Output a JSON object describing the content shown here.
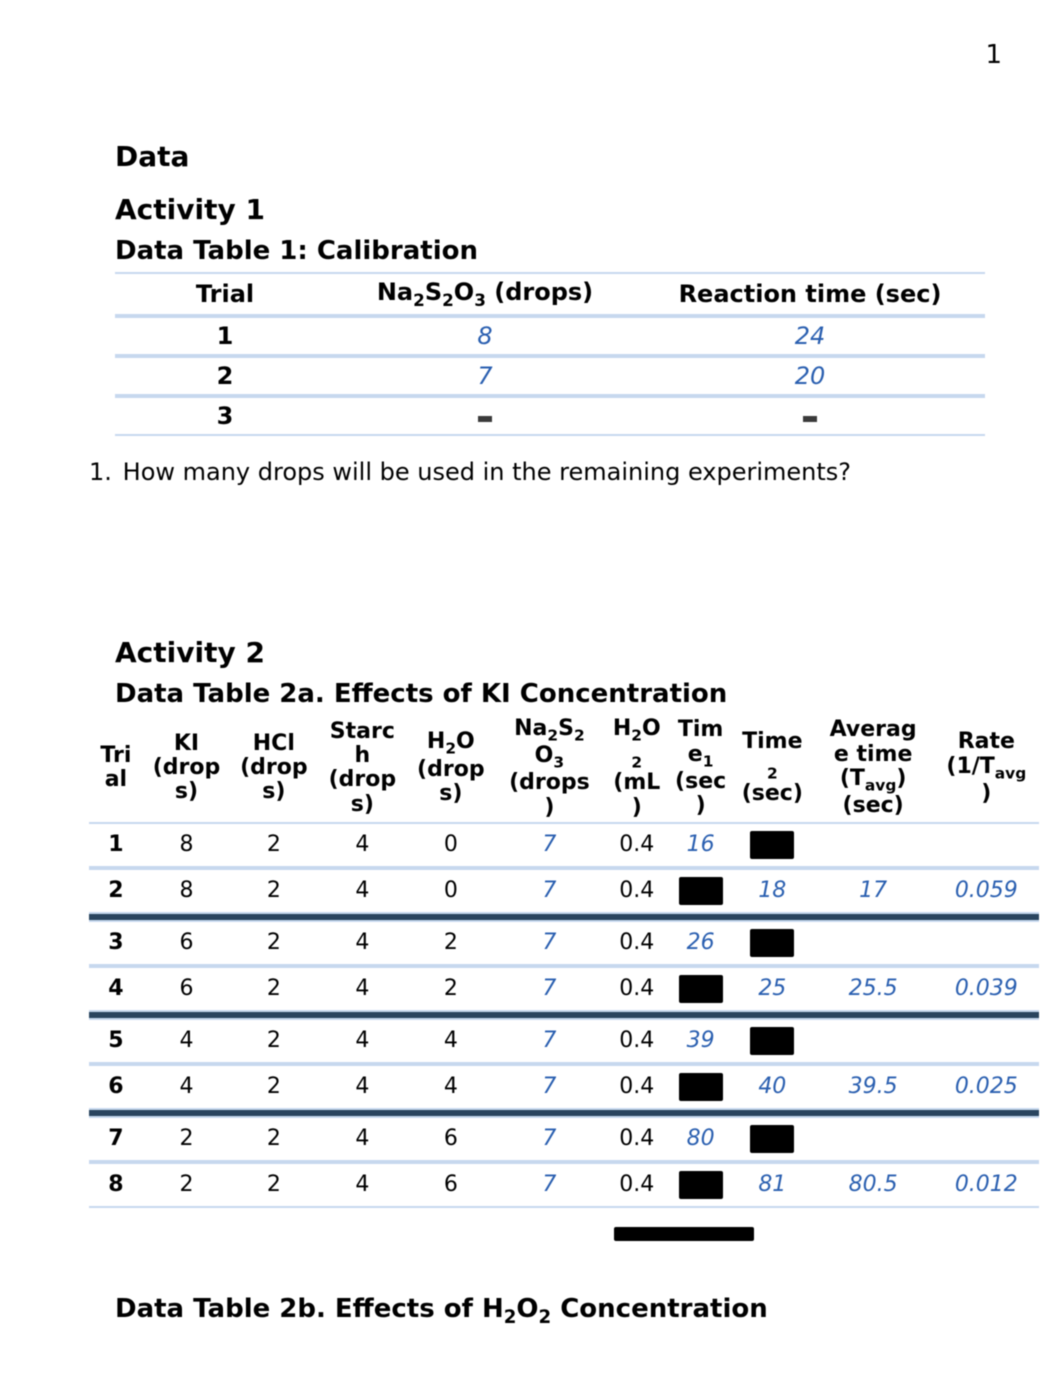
{
  "page_number": "1",
  "section_heading": "Data",
  "activity1": {
    "heading": "Activity 1",
    "table_title": "Data Table 1: Calibration",
    "headers": {
      "trial": "Trial",
      "drops_prefix": "Na",
      "drops_sub1": "2",
      "drops_mid1": "S",
      "drops_sub2": "2",
      "drops_mid2": "O",
      "drops_sub3": "3",
      "drops_suffix": " (drops)",
      "time": "Reaction time (sec)"
    },
    "rows": [
      {
        "trial": "1",
        "drops": "8",
        "time": "24"
      },
      {
        "trial": "2",
        "drops": "7",
        "time": "20"
      },
      {
        "trial": "3",
        "drops": "",
        "time": ""
      }
    ],
    "question_num": "1.",
    "question_text": "How many drops will be used in the remaining experiments?"
  },
  "activity2": {
    "heading": "Activity 2",
    "table2a_title": "Data Table 2a. Effects of KI Concentration",
    "headers": {
      "trial_l1": "Tri",
      "trial_l2": "al",
      "ki_l1": "KI",
      "ki_l2": "(drop",
      "ki_l3": "s)",
      "hcl_l1": "HCl",
      "hcl_l2": "(drop",
      "hcl_l3": "s)",
      "starch_l1": "Starc",
      "starch_l2": "h",
      "starch_l3": "(drop",
      "starch_l4": "s)",
      "h2o_pre": "H",
      "h2o_sub": "2",
      "h2o_post": "O",
      "h2o_l2": "(drop",
      "h2o_l3": "s)",
      "na_pre": "Na",
      "na_s1": "2",
      "na_m1": "S",
      "na_s2": "2",
      "na_l2_pre": "O",
      "na_l2_sub": "3",
      "na_l3": "(drops",
      "na_l4": ")",
      "h2o2_pre": "H",
      "h2o2_s1": "2",
      "h2o2_m": "O",
      "h2o2_l2_sub": "2",
      "h2o2_l3": "(mL",
      "h2o2_l4": ")",
      "t1_l1": "Tim",
      "t1_l2_pre": "e",
      "t1_l2_sub": "1",
      "t1_l3": "(sec",
      "t1_l4": ")",
      "t2_l1": "Time",
      "t2_l2_sub": "2",
      "t2_l3": "(sec)",
      "avg_l1": "Averag",
      "avg_l2": "e time",
      "avg_l3_pre": "(T",
      "avg_l3_sub": "avg",
      "avg_l3_post": ")",
      "avg_l4": "(sec)",
      "rate_l1": "Rate",
      "rate_l2_pre": "(1/T",
      "rate_l2_sub": "avg",
      "rate_l3": ")"
    },
    "chart_data": {
      "type": "table",
      "rows": [
        {
          "trial": "1",
          "ki": "8",
          "hcl": "2",
          "starch": "4",
          "h2o": "0",
          "na": "7",
          "h2o2": "0.4",
          "t1": "16",
          "t2": "",
          "avg": "",
          "rate": ""
        },
        {
          "trial": "2",
          "ki": "8",
          "hcl": "2",
          "starch": "4",
          "h2o": "0",
          "na": "7",
          "h2o2": "0.4",
          "t1": "",
          "t2": "18",
          "avg": "17",
          "rate": "0.059"
        },
        {
          "trial": "3",
          "ki": "6",
          "hcl": "2",
          "starch": "4",
          "h2o": "2",
          "na": "7",
          "h2o2": "0.4",
          "t1": "26",
          "t2": "",
          "avg": "",
          "rate": ""
        },
        {
          "trial": "4",
          "ki": "6",
          "hcl": "2",
          "starch": "4",
          "h2o": "2",
          "na": "7",
          "h2o2": "0.4",
          "t1": "",
          "t2": "25",
          "avg": "25.5",
          "rate": "0.039"
        },
        {
          "trial": "5",
          "ki": "4",
          "hcl": "2",
          "starch": "4",
          "h2o": "4",
          "na": "7",
          "h2o2": "0.4",
          "t1": "39",
          "t2": "",
          "avg": "",
          "rate": ""
        },
        {
          "trial": "6",
          "ki": "4",
          "hcl": "2",
          "starch": "4",
          "h2o": "4",
          "na": "7",
          "h2o2": "0.4",
          "t1": "",
          "t2": "40",
          "avg": "39.5",
          "rate": "0.025"
        },
        {
          "trial": "7",
          "ki": "2",
          "hcl": "2",
          "starch": "4",
          "h2o": "6",
          "na": "7",
          "h2o2": "0.4",
          "t1": "80",
          "t2": "",
          "avg": "",
          "rate": ""
        },
        {
          "trial": "8",
          "ki": "2",
          "hcl": "2",
          "starch": "4",
          "h2o": "6",
          "na": "7",
          "h2o2": "0.4",
          "t1": "",
          "t2": "81",
          "avg": "80.5",
          "rate": "0.012"
        }
      ]
    },
    "table2b_title_pre": "Data Table 2b. Effects of H",
    "table2b_title_sub1": "2",
    "table2b_title_mid": "O",
    "table2b_title_sub2": "2",
    "table2b_title_post": " Concentration"
  }
}
